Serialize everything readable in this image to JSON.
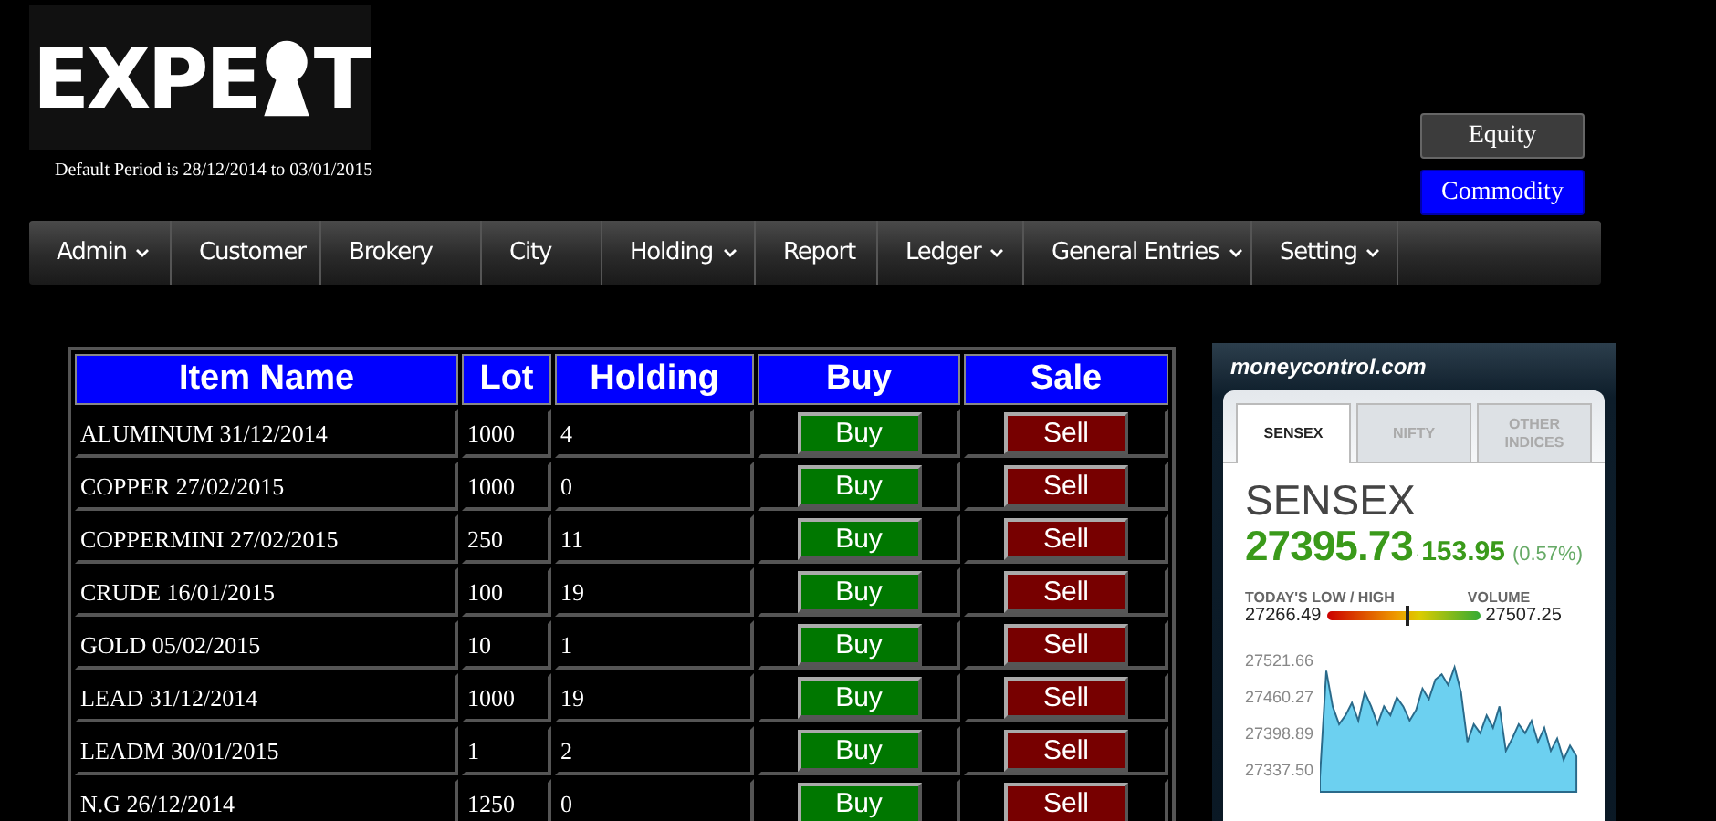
{
  "logo": {
    "before": "EXPE",
    "after": "T"
  },
  "period": "Default Period is 28/12/2014 to 03/01/2015",
  "segments": [
    {
      "label": "Equity",
      "selected": false
    },
    {
      "label": "Commodity",
      "selected": true
    }
  ],
  "menu": [
    {
      "label": "Admin",
      "dropdown": true
    },
    {
      "label": "Customer",
      "dropdown": false
    },
    {
      "label": "Brokery",
      "dropdown": false
    },
    {
      "label": "City",
      "dropdown": false
    },
    {
      "label": "Holding",
      "dropdown": true
    },
    {
      "label": "Report",
      "dropdown": false
    },
    {
      "label": "Ledger",
      "dropdown": true
    },
    {
      "label": "General Entries",
      "dropdown": true
    },
    {
      "label": "Setting",
      "dropdown": true
    }
  ],
  "table": {
    "columns": [
      "Item Name",
      "Lot",
      "Holding",
      "Buy",
      "Sale"
    ],
    "rows": [
      {
        "item": "ALUMINUM 31/12/2014",
        "lot": "1000",
        "holding": "4",
        "buy": "Buy",
        "sell": "Sell"
      },
      {
        "item": "COPPER 27/02/2015",
        "lot": "1000",
        "holding": "0",
        "buy": "Buy",
        "sell": "Sell"
      },
      {
        "item": "COPPERMINI 27/02/2015",
        "lot": "250",
        "holding": "11",
        "buy": "Buy",
        "sell": "Sell"
      },
      {
        "item": "CRUDE 16/01/2015",
        "lot": "100",
        "holding": "19",
        "buy": "Buy",
        "sell": "Sell"
      },
      {
        "item": "GOLD 05/02/2015",
        "lot": "10",
        "holding": "1",
        "buy": "Buy",
        "sell": "Sell"
      },
      {
        "item": "LEAD 31/12/2014",
        "lot": "1000",
        "holding": "19",
        "buy": "Buy",
        "sell": "Sell"
      },
      {
        "item": "LEADM 30/01/2015",
        "lot": "1",
        "holding": "2",
        "buy": "Buy",
        "sell": "Sell"
      },
      {
        "item": "N.G 26/12/2014",
        "lot": "1250",
        "holding": "0",
        "buy": "Buy",
        "sell": "Sell"
      }
    ]
  },
  "widget": {
    "brand": "moneycontrol.com",
    "tabs": [
      {
        "label": "SENSEX",
        "selected": true
      },
      {
        "label": "NIFTY",
        "selected": false
      },
      {
        "label": "OTHER INDICES",
        "selected": false
      }
    ],
    "index_name": "SENSEX",
    "value": "27395.73",
    "change": "153.95",
    "change_pct": "(0.57%)",
    "range_label": "TODAY'S LOW / HIGH",
    "volume_label": "VOLUME",
    "low": "27266.49",
    "high": "27507.25",
    "range": {
      "level": 0.53
    },
    "y_axis_labels": [
      "27521.66",
      "27460.27",
      "27398.89",
      "27337.50"
    ]
  }
}
